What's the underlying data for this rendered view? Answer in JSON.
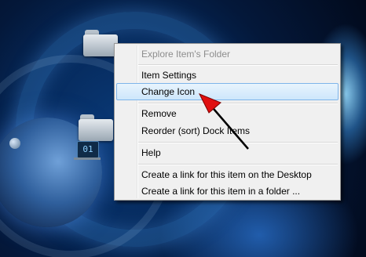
{
  "menu": {
    "items": [
      {
        "label": "Explore Item's Folder",
        "enabled": false
      },
      {
        "label": "Item Settings",
        "enabled": true
      },
      {
        "label": "Change Icon",
        "enabled": true,
        "highlighted": true
      },
      {
        "label": "Remove",
        "enabled": true
      },
      {
        "label": "Reorder (sort) Dock Items",
        "enabled": true
      },
      {
        "label": "Help",
        "enabled": true
      },
      {
        "label": "Create a link for this item on the Desktop",
        "enabled": true
      },
      {
        "label": "Create a link for this item in a folder ...",
        "enabled": true
      }
    ]
  },
  "desktop": {
    "dock_screen_icon_text": "01"
  },
  "colors": {
    "highlight_border": "#7eb4ea",
    "annotation_arrow": "#e01010"
  }
}
